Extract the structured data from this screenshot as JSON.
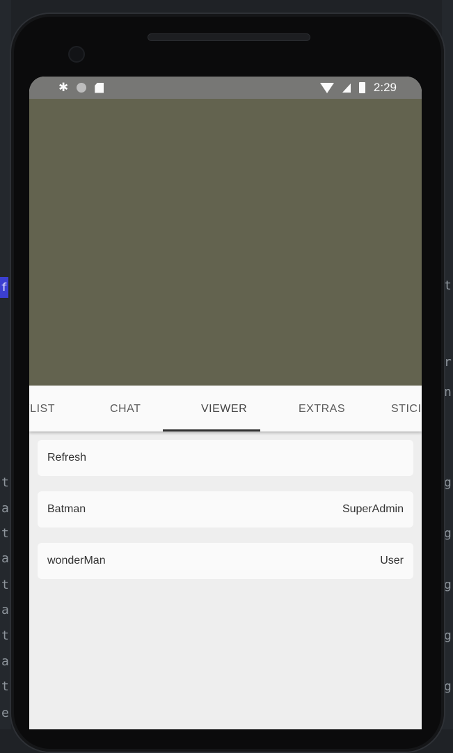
{
  "status_bar": {
    "time": "2:29",
    "icons": [
      "settings-icon",
      "circle-icon",
      "sd-card-icon",
      "wifi-icon",
      "signal-icon",
      "battery-icon"
    ]
  },
  "tabs": [
    {
      "label": "YLIST"
    },
    {
      "label": "CHAT"
    },
    {
      "label": "VIEWER",
      "selected": true
    },
    {
      "label": "EXTRAS"
    },
    {
      "label": "STICI"
    }
  ],
  "refresh_label": "Refresh",
  "viewers": [
    {
      "name": "Batman",
      "role": "SuperAdmin"
    },
    {
      "name": "wonderMan",
      "role": "User"
    }
  ],
  "background_ide": {
    "highlight_char": "f",
    "left_chars": [
      "t",
      "a",
      "t",
      "a",
      "t",
      "a",
      "t",
      "a",
      "t",
      "e"
    ],
    "right_chars": [
      "t",
      "r",
      "n",
      "g",
      "g",
      "g",
      "g",
      "g"
    ]
  },
  "colors": {
    "video_area": "#63634f",
    "status_bar": "#777775",
    "tab_indicator": "#333333"
  }
}
